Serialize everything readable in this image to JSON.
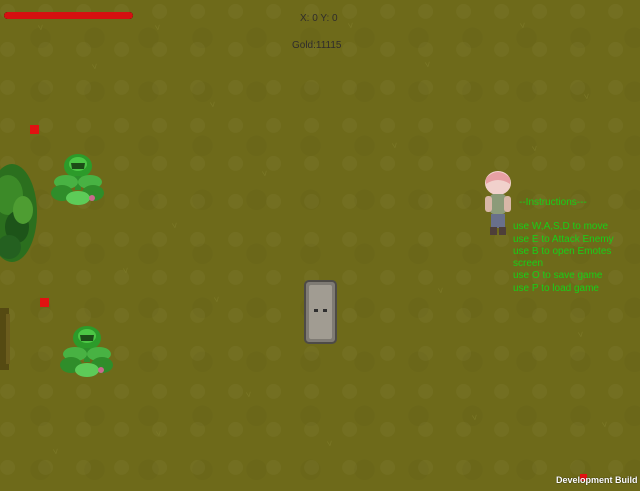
{
  "hud": {
    "health_fraction": 1.0,
    "coordinates_text": "X: 0 Y: 0",
    "gold_text": "Gold:11115"
  },
  "instructions": {
    "title": "--Instructions---",
    "lines": [
      "use W,A,S,D to move",
      "use E to Attack Enemy",
      "use B to open Emotes screen",
      "use O to save game",
      "use P to load game"
    ]
  },
  "footer": {
    "build_label": "Development Build"
  },
  "colors": {
    "ground": "#6e6a1a",
    "health": "#d61010",
    "instructions_text": "#18cf18",
    "marker": "#e11111"
  },
  "icons": {
    "player": "player-character-icon",
    "enemy": "plant-enemy-icon",
    "obstacle": "stone-pillar-icon",
    "foliage": "bush-icon",
    "marker": "red-square-marker"
  }
}
